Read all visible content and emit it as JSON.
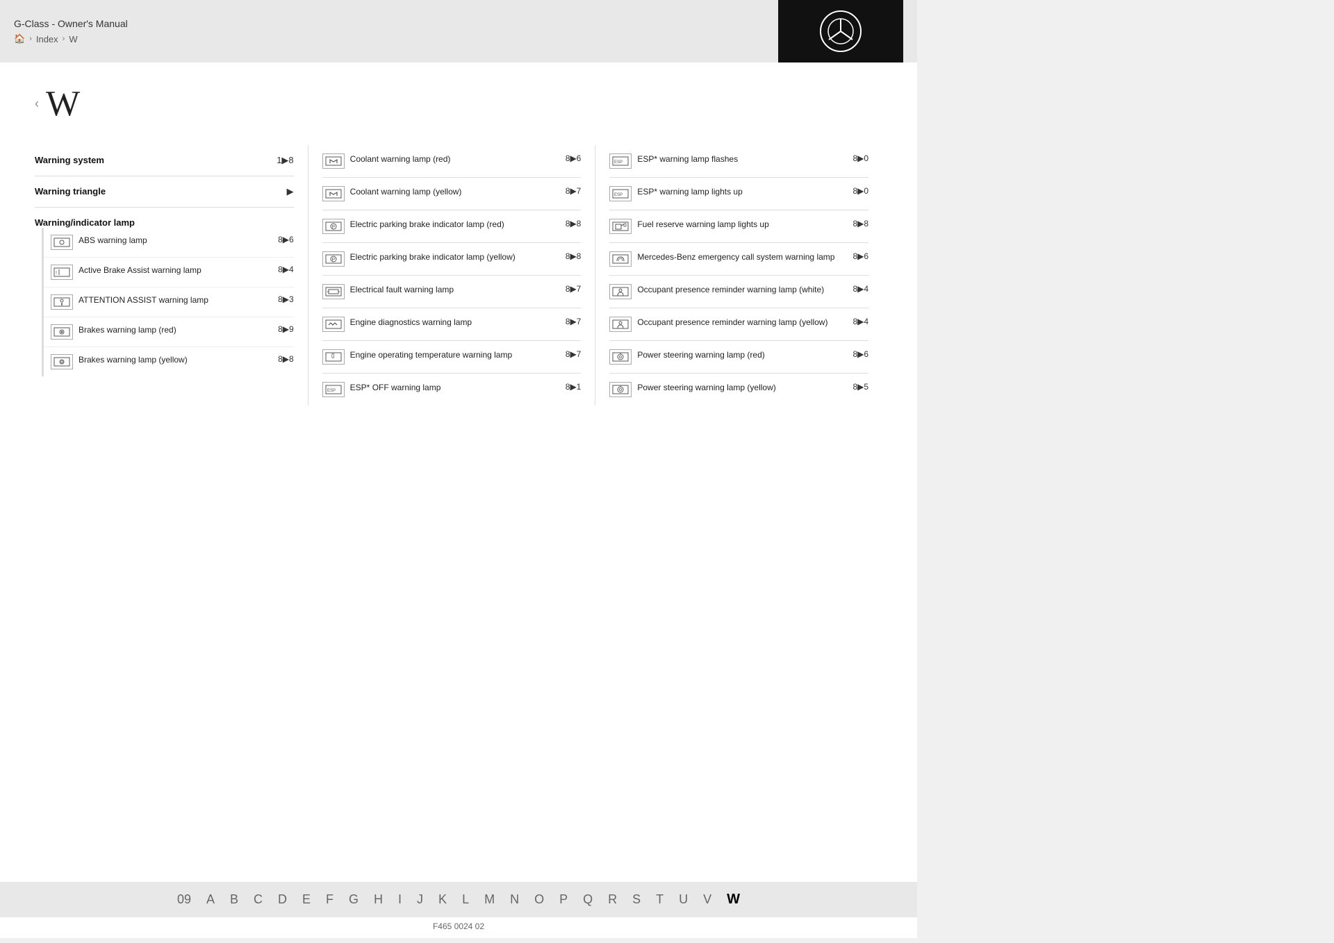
{
  "header": {
    "title": "G-Class - Owner's Manual",
    "breadcrumb": [
      "🏠",
      "Index",
      "W"
    ]
  },
  "page_letter": "W",
  "footer_code": "F465 0024 02",
  "left_col": {
    "sections": [
      {
        "label": "Warning system",
        "ref": "1▶8"
      },
      {
        "label": "Warning triangle",
        "ref": "▶"
      }
    ],
    "sub_heading": "Warning/indicator lamp",
    "sub_items": [
      {
        "icon": "⊙",
        "text": "ABS warning lamp",
        "ref": "8▶6"
      },
      {
        "icon": "🚗",
        "text": "Active Brake Assist warning lamp",
        "ref": "8▶4"
      },
      {
        "icon": "👤",
        "text": "ATTENTION ASSIST warning lamp",
        "ref": "8▶3"
      },
      {
        "icon": "⊙",
        "text": "Brakes warning lamp (red)",
        "ref": "8▶9"
      },
      {
        "icon": "⊙",
        "text": "Brakes warning lamp (yellow)",
        "ref": "8▶8"
      }
    ]
  },
  "mid_col": {
    "items": [
      {
        "icon": "⬆",
        "text": "Coolant warning lamp (red)",
        "ref": "8▶6"
      },
      {
        "icon": "⬆",
        "text": "Coolant warning lamp (yellow)",
        "ref": "8▶7"
      },
      {
        "icon": "⊙",
        "text": "Electric parking brake indicator lamp (red)",
        "ref": "8▶8"
      },
      {
        "icon": "⊙",
        "text": "Electric parking brake indicator lamp (yellow)",
        "ref": "8▶8"
      },
      {
        "icon": "⬜",
        "text": "Electrical fault warning lamp",
        "ref": "8▶7"
      },
      {
        "icon": "⚙",
        "text": "Engine diagnostics warning lamp",
        "ref": "8▶7"
      },
      {
        "icon": "🌡",
        "text": "Engine operating temperature warning lamp",
        "ref": "8▶7"
      },
      {
        "icon": "ESP",
        "text": "ESP* OFF warning lamp",
        "ref": "8▶1"
      }
    ]
  },
  "right_col": {
    "items": [
      {
        "icon": "ESP",
        "text": "ESP* warning lamp flashes",
        "ref": "8▶0"
      },
      {
        "icon": "ESP",
        "text": "ESP* warning lamp lights up",
        "ref": "8▶0"
      },
      {
        "icon": "⛽",
        "text": "Fuel reserve warning lamp lights up",
        "ref": "8▶8"
      },
      {
        "icon": "📞",
        "text": "Mercedes-Benz emergency call system warning lamp",
        "ref": "8▶6"
      },
      {
        "icon": "👤",
        "text": "Occupant presence reminder warning lamp (white)",
        "ref": "8▶4"
      },
      {
        "icon": "👤",
        "text": "Occupant presence reminder warning lamp (yellow)",
        "ref": "8▶4"
      },
      {
        "icon": "🔧",
        "text": "Power steering warning lamp (red)",
        "ref": "8▶6"
      },
      {
        "icon": "🔧",
        "text": "Power steering warning lamp (yellow)",
        "ref": "8▶5"
      }
    ]
  },
  "bottom_nav": [
    "09",
    "A",
    "B",
    "C",
    "D",
    "E",
    "F",
    "G",
    "H",
    "I",
    "J",
    "K",
    "L",
    "M",
    "N",
    "O",
    "P",
    "Q",
    "R",
    "S",
    "T",
    "U",
    "V",
    "W"
  ],
  "active_nav": "W"
}
